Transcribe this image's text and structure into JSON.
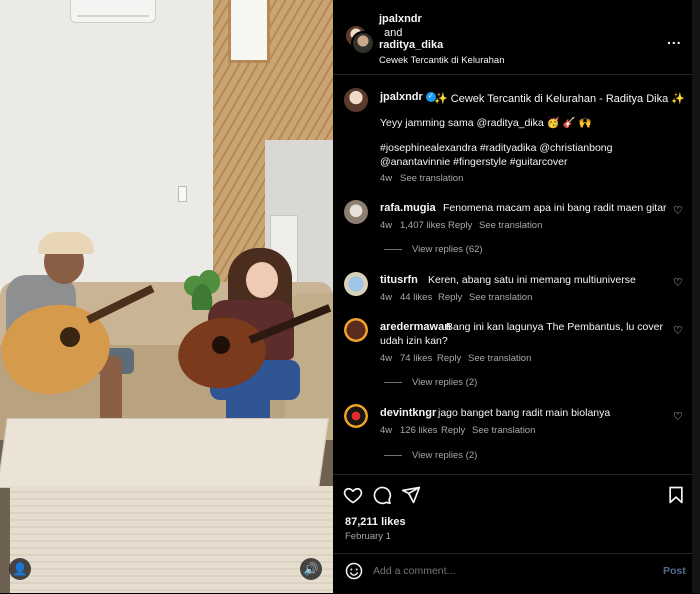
{
  "header": {
    "user1": "jpalxndr",
    "and_text": "and",
    "user2": "raditya_dika",
    "audio": "Cewek Tercantik di Kelurahan",
    "more_label": "..."
  },
  "caption": {
    "username": "jpalxndr",
    "verified_glyph": "✓",
    "title": "✨ Cewek Tercantik di Kelurahan - Raditya Dika ✨",
    "line1": "Yeyy jamming sama @raditya_dika 🥳 🎸 🙌",
    "line2": "#josephinealexandra #radityadika @christianbong",
    "line3": "@anantavinnie #fingerstyle #guitarcover",
    "time": "4w",
    "translation": "See translation"
  },
  "comments": [
    {
      "username": "rafa.mugia",
      "text": "Fenomena macam apa ini bang radit maen gitar",
      "time": "4w",
      "likes": "1,407 likes",
      "reply": "Reply",
      "translation": "See translation",
      "view_replies": "View replies (62)"
    },
    {
      "username": "titusrfn",
      "text": "Keren, abang satu ini memang multiuniverse",
      "time": "4w",
      "likes": "44 likes",
      "reply": "Reply",
      "translation": "See translation"
    },
    {
      "username": "aredermawan",
      "text": "Bang ini kan lagunya The Pembantus, lu cover",
      "text2": "udah izin kan?",
      "time": "4w",
      "likes": "74 likes",
      "reply": "Reply",
      "translation": "See translation",
      "view_replies": "View replies (2)"
    },
    {
      "username": "devintkngr",
      "text": "jago banget bang radit main biolanya",
      "time": "4w",
      "likes": "126 likes",
      "reply": "Reply",
      "translation": "See translation",
      "view_replies": "View replies (2)"
    }
  ],
  "actions": {
    "likes": "87,211 likes",
    "date": "February 1"
  },
  "add_comment": {
    "placeholder": "Add a comment...",
    "post_label": "Post"
  },
  "media": {
    "user_glyph": "👤",
    "sound_glyph": "🔊"
  },
  "icons": {
    "like": "heart-icon",
    "comment": "comment-icon",
    "share": "send-icon",
    "save": "bookmark-icon",
    "emoji": "emoji-icon",
    "verified": "verified-badge-icon"
  },
  "colors": {
    "background": "#000000",
    "text": "#f5f5f5",
    "secondary_text": "#a8a8a8",
    "verified": "#1d9bf0",
    "post_disabled": "#4f6b8f"
  }
}
